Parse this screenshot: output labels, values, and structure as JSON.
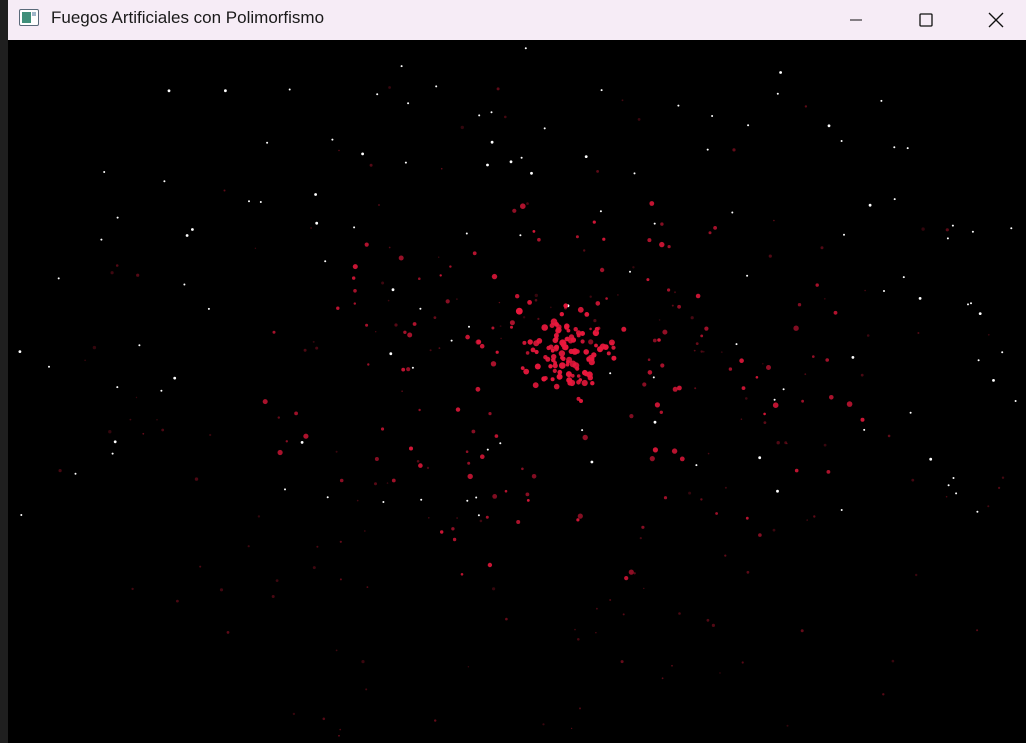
{
  "window": {
    "title": "Fuegos Artificiales con Polimorfismo",
    "app_icon": "window-app-icon",
    "controls": [
      "minimize-icon",
      "maximize-icon",
      "close-icon"
    ]
  },
  "scene": {
    "background": "#000000",
    "star_color": "#ffffff",
    "firework_color": "#e8183c",
    "firework_dim_color": "#8a0f22"
  }
}
